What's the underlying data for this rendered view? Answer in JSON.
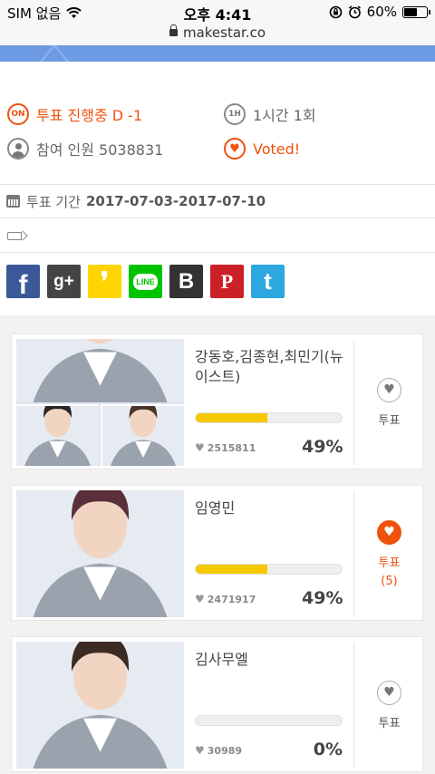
{
  "status": {
    "carrier": "SIM 없음",
    "time": "오후 4:41",
    "battery": "60%"
  },
  "url": "makestar.co",
  "info": {
    "on_badge": "ON",
    "status_text": "투표 진행중 D -1",
    "freq_badge": "1H",
    "frequency": "1시간 1회",
    "participants": "참여 인원 5038831",
    "voted": "Voted!"
  },
  "period": {
    "label": "투표 기간",
    "dates": "2017-07-03-2017-07-10"
  },
  "share": [
    {
      "name": "facebook",
      "glyph": "f",
      "color": "#3b5998"
    },
    {
      "name": "google-plus",
      "glyph": "g+",
      "color": "#444444"
    },
    {
      "name": "kakaostory",
      "glyph": "❜",
      "color": "#ffd400"
    },
    {
      "name": "line",
      "glyph": "LINE",
      "color": "#00c300"
    },
    {
      "name": "band",
      "glyph": "B",
      "color": "#333333"
    },
    {
      "name": "pinterest",
      "glyph": "P",
      "color": "#cb2027"
    },
    {
      "name": "twitter",
      "glyph": "t",
      "color": "#2ca7e0"
    }
  ],
  "candidates": [
    {
      "name": "강동호,김종현,최민기(뉴이스트)",
      "count": "2515811",
      "percent": "49%",
      "share": 0.49,
      "vote_label": "투표",
      "voted": false,
      "my_votes": ""
    },
    {
      "name": "임영민",
      "count": "2471917",
      "percent": "49%",
      "share": 0.49,
      "vote_label": "투표",
      "voted": true,
      "my_votes": "(5)"
    },
    {
      "name": "김사무엘",
      "count": "30989",
      "percent": "0%",
      "share": 0.0,
      "vote_label": "투표",
      "voted": false,
      "my_votes": ""
    }
  ]
}
